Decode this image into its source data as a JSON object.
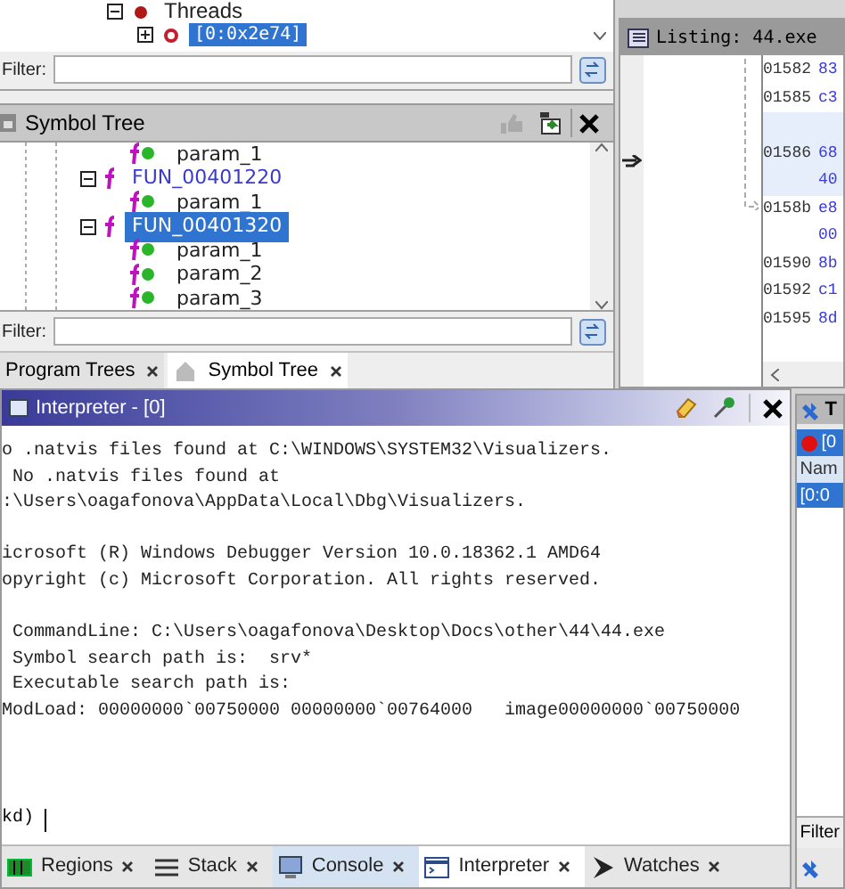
{
  "program_tree": {
    "items": [
      {
        "label": "Threads",
        "expanded": true,
        "selected": false,
        "children": [
          {
            "label": "[0:0x2e74]",
            "expanded": false,
            "selected": true
          }
        ]
      }
    ],
    "filter": {
      "label": "Filter:"
    }
  },
  "symbol_tree": {
    "title": "Symbol Tree",
    "items": [
      {
        "kind": "param",
        "label": "param_1",
        "selected": false
      },
      {
        "kind": "function",
        "label": "FUN_00401220",
        "selected": false
      },
      {
        "kind": "param",
        "label": "param_1",
        "selected": false
      },
      {
        "kind": "function",
        "label": "FUN_00401320",
        "selected": true
      },
      {
        "kind": "param",
        "label": "param_1",
        "selected": false
      },
      {
        "kind": "param",
        "label": "param_2",
        "selected": false
      },
      {
        "kind": "param",
        "label": "param_3",
        "selected": false
      }
    ],
    "filter": {
      "label": "Filter:"
    }
  },
  "left_tabs": [
    {
      "label": "Program Trees",
      "selected": false
    },
    {
      "label": "Symbol Tree",
      "selected": true
    }
  ],
  "listing": {
    "title": "Listing: 44.exe",
    "rows": [
      {
        "address": "01582",
        "bytes": "83",
        "highlighted": false
      },
      {
        "address": "01585",
        "bytes": "c3",
        "highlighted": false
      },
      {
        "address": "",
        "bytes": "",
        "highlighted": true
      },
      {
        "address": "01586",
        "bytes": "68",
        "highlighted": true
      },
      {
        "address": "",
        "bytes": "40",
        "highlighted": true
      },
      {
        "address": "0158b",
        "bytes": "e8",
        "highlighted": false
      },
      {
        "address": "",
        "bytes": "00",
        "highlighted": false
      },
      {
        "address": "01590",
        "bytes": "8b",
        "highlighted": false
      },
      {
        "address": "01592",
        "bytes": "c1",
        "highlighted": false
      },
      {
        "address": "01595",
        "bytes": "8d",
        "highlighted": false
      }
    ]
  },
  "interpreter": {
    "title": "Interpreter - [0]",
    "lines": [
      {
        "text": "o .natvis files found at C:\\WINDOWS\\SYSTEM32\\Visualizers.",
        "blank_before": false
      },
      {
        "text": " No .natvis files found at",
        "blank_before": false
      },
      {
        "text": ":\\Users\\oagafonova\\AppData\\Local\\Dbg\\Visualizers.",
        "blank_before": false
      },
      {
        "text": "icrosoft (R) Windows Debugger Version 10.0.18362.1 AMD64",
        "blank_before": true
      },
      {
        "text": "opyright (c) Microsoft Corporation. All rights reserved.",
        "blank_before": false
      },
      {
        "text": " CommandLine: C:\\Users\\oagafonova\\Desktop\\Docs\\other\\44\\44.exe",
        "blank_before": true
      },
      {
        "text": " Symbol search path is:  srv*",
        "blank_before": false
      },
      {
        "text": " Executable search path is:",
        "blank_before": false
      },
      {
        "text": "ModLoad: 00000000`00750000 00000000`00764000   image00000000`00750000",
        "blank_before": false
      }
    ],
    "prompt": "kd)"
  },
  "bottom_tabs": [
    {
      "kind": "regions",
      "label": "Regions",
      "selected": false
    },
    {
      "kind": "stack",
      "label": "Stack",
      "selected": false
    },
    {
      "kind": "console",
      "label": "Console",
      "selected": false
    },
    {
      "kind": "interpreter",
      "label": "Interpreter",
      "selected": true
    },
    {
      "kind": "watches",
      "label": "Watches",
      "selected": false
    }
  ],
  "threads_panel": {
    "tab": "T",
    "header": "[0",
    "column": "Nam",
    "rows": [
      {
        "label": "[0:0",
        "selected": true
      }
    ],
    "filter": "Filter"
  }
}
